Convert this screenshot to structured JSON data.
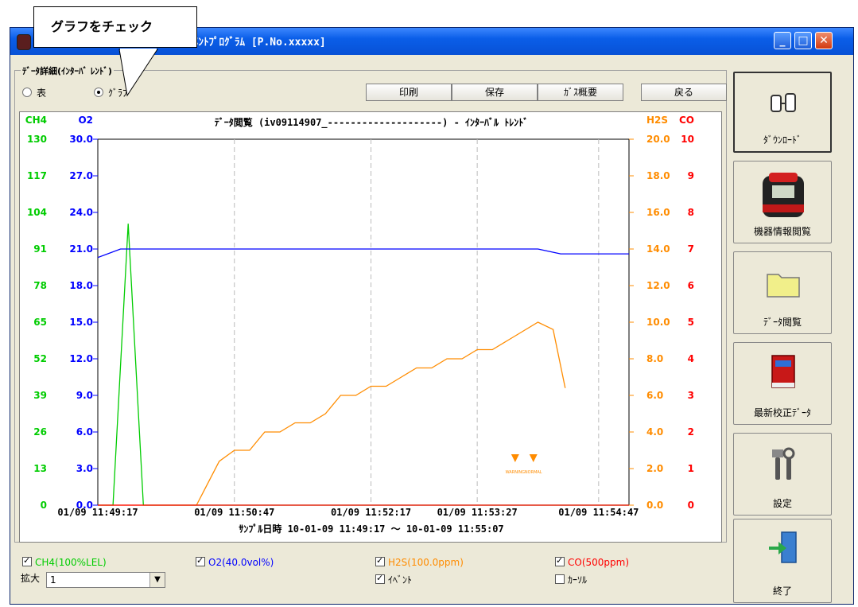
{
  "window": {
    "title": "ﾒﾝﾄﾌﾟﾛｸﾞﾗﾑ [P.No.xxxxx]"
  },
  "callout": {
    "text": "グラフをチェック"
  },
  "panel": {
    "legend": "ﾃﾞｰﾀ詳細(ｲﾝﾀｰﾊﾞ ﾚﾝﾄﾞ)",
    "radio_table": "表",
    "radio_graph": "ｸﾞﾗﾌ"
  },
  "toolbar": {
    "print": "印刷",
    "save": "保存",
    "gas_summary": "ｶﾞｽ概要",
    "back": "戻る"
  },
  "sidebar": {
    "download": "ﾀﾞｳﾝﾛｰﾄﾞ",
    "device_info": "機器情報閲覧",
    "data_view": "ﾃﾞｰﾀ閲覧",
    "calibration": "最新校正ﾃﾞｰﾀ",
    "settings": "設定",
    "exit": "終了"
  },
  "bottom": {
    "ch4": "CH4(100%LEL)",
    "o2": "O2(40.0vol%)",
    "h2s": "H2S(100.0ppm)",
    "co": "CO(500ppm)",
    "event": "ｲﾍﾞﾝﾄ",
    "cursor": "ｶｰｿﾙ",
    "zoom_label": "拡大",
    "zoom_value": "1"
  },
  "colors": {
    "ch4": "#00cc00",
    "o2": "#0000ff",
    "h2s": "#ff8c00",
    "co": "#ff0000"
  },
  "chart_data": {
    "type": "line",
    "title": "ﾃﾞｰﾀ閲覧 (iv09114907_--------------------) - ｲﾝﾀｰﾊﾞﾙ ﾄﾚﾝﾄﾞ",
    "xlabel": "ｻﾝﾌﾟﾙ日時 10-01-09 11:49:17 ～ 10-01-09 11:55:07",
    "x_range": [
      "01/09 11:49:17",
      "01/09 11:55:07"
    ],
    "x_ticks": [
      "01/09 11:49:17",
      "01/09 11:50:47",
      "01/09 11:52:17",
      "01/09 11:53:27",
      "01/09 11:54:47"
    ],
    "axes": {
      "ch4": {
        "label": "CH4",
        "ticks": [
          "0",
          "13",
          "26",
          "39",
          "52",
          "65",
          "78",
          "91",
          "104",
          "117",
          "130"
        ],
        "ylim": [
          0,
          130
        ]
      },
      "o2": {
        "label": "O2",
        "ticks": [
          "0.0",
          "3.0",
          "6.0",
          "9.0",
          "12.0",
          "15.0",
          "18.0",
          "21.0",
          "24.0",
          "27.0",
          "30.0"
        ],
        "ylim": [
          0,
          30
        ]
      },
      "h2s": {
        "label": "H2S",
        "ticks": [
          "0.0",
          "2.0",
          "4.0",
          "6.0",
          "8.0",
          "10.0",
          "12.0",
          "14.0",
          "16.0",
          "18.0",
          "20.0"
        ],
        "ylim": [
          0,
          20
        ]
      },
      "co": {
        "label": "CO",
        "ticks": [
          "0",
          "1",
          "2",
          "3",
          "4",
          "5",
          "6",
          "7",
          "8",
          "9",
          "10"
        ],
        "ylim": [
          0,
          10
        ]
      }
    },
    "series": [
      {
        "name": "CH4",
        "axis": "ch4",
        "color": "#00cc00",
        "points": [
          [
            0,
            0
          ],
          [
            10,
            0
          ],
          [
            20,
            100
          ],
          [
            30,
            0
          ],
          [
            350,
            0
          ]
        ]
      },
      {
        "name": "O2",
        "axis": "o2",
        "color": "#0000ff",
        "points": [
          [
            0,
            20.3
          ],
          [
            15,
            21.0
          ],
          [
            290,
            21.0
          ],
          [
            305,
            20.6
          ],
          [
            350,
            20.6
          ]
        ]
      },
      {
        "name": "H2S",
        "axis": "h2s",
        "color": "#ff8c00",
        "points": [
          [
            0,
            0
          ],
          [
            65,
            0
          ],
          [
            80,
            2.4
          ],
          [
            90,
            3.0
          ],
          [
            100,
            3.0
          ],
          [
            110,
            4.0
          ],
          [
            120,
            4.0
          ],
          [
            130,
            4.5
          ],
          [
            140,
            4.5
          ],
          [
            150,
            5.0
          ],
          [
            160,
            6.0
          ],
          [
            170,
            6.0
          ],
          [
            180,
            6.5
          ],
          [
            190,
            6.5
          ],
          [
            200,
            7.0
          ],
          [
            210,
            7.5
          ],
          [
            220,
            7.5
          ],
          [
            230,
            8.0
          ],
          [
            240,
            8.0
          ],
          [
            250,
            8.5
          ],
          [
            260,
            8.5
          ],
          [
            270,
            9.0
          ],
          [
            280,
            9.5
          ],
          [
            290,
            10.0
          ],
          [
            300,
            9.6
          ],
          [
            308,
            6.4
          ]
        ]
      },
      {
        "name": "CO",
        "axis": "co",
        "color": "#ff0000",
        "points": [
          [
            0,
            0
          ],
          [
            350,
            0
          ]
        ]
      }
    ],
    "event_markers": [
      {
        "x": 275,
        "label": "WARNING"
      },
      {
        "x": 287,
        "label": "NORMAL"
      }
    ],
    "grid": true
  }
}
